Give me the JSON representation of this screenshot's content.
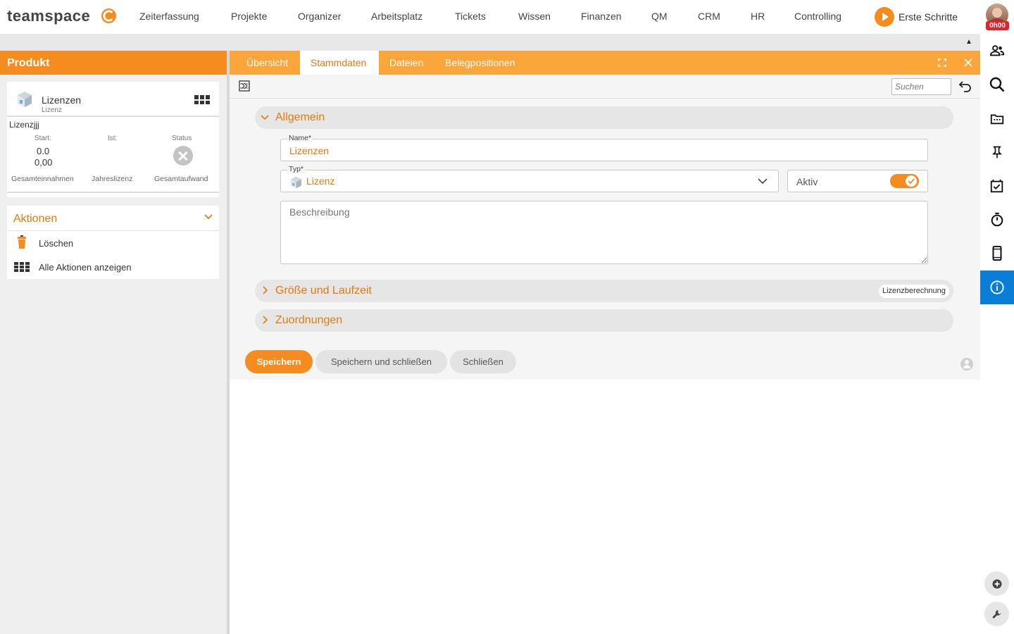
{
  "app": {
    "logo": "teamspace"
  },
  "nav": {
    "items": [
      "Zeiterfassung",
      "Projekte",
      "Organizer",
      "Arbeitsplatz",
      "Tickets",
      "Wissen",
      "Finanzen",
      "QM",
      "CRM",
      "HR",
      "Controlling"
    ],
    "erste_schritte": "Erste Schritte",
    "avatar_badge": "0h00"
  },
  "left_panel": {
    "title": "Produkt",
    "card": {
      "name": "Lizenzen",
      "subtitle": "Lizenz",
      "line2": "Lizenzjjj",
      "start_label": "Start:",
      "ist_label": "Ist:",
      "status_label": "Status",
      "start_value_1": "0.0",
      "start_value_2": "0,00",
      "footer_1": "Gesamteinnahmen",
      "footer_2": "Jahreslizenz",
      "footer_3": "Gesamtaufwand"
    },
    "actions": {
      "title": "Aktionen",
      "items": [
        "Löschen",
        "Alle Aktionen anzeigen"
      ]
    }
  },
  "tabs": [
    "Übersicht",
    "Stammdaten",
    "Dateien",
    "Belegpositionen"
  ],
  "active_tab": "Stammdaten",
  "toolbar": {
    "search_placeholder": "Suchen"
  },
  "form": {
    "section_general": "Allgemein",
    "name_label": "Name*",
    "name_value": "Lizenzen",
    "typ_label": "Typ*",
    "typ_value": "Lizenz",
    "aktiv_label": "Aktiv",
    "aktiv_on": true,
    "beschreibung_placeholder": "Beschreibung",
    "section_size": "Größe und Laufzeit",
    "calc_button": "Lizenzberechnung",
    "section_assign": "Zuordnungen"
  },
  "buttons": {
    "save": "Speichern",
    "save_close": "Speichern und schließen",
    "close": "Schließen"
  },
  "colors": {
    "accent": "#f68b1f",
    "accent_text": "#e07b0b",
    "tab_bar": "#fba63a",
    "active_rail": "#0a7ed6"
  }
}
